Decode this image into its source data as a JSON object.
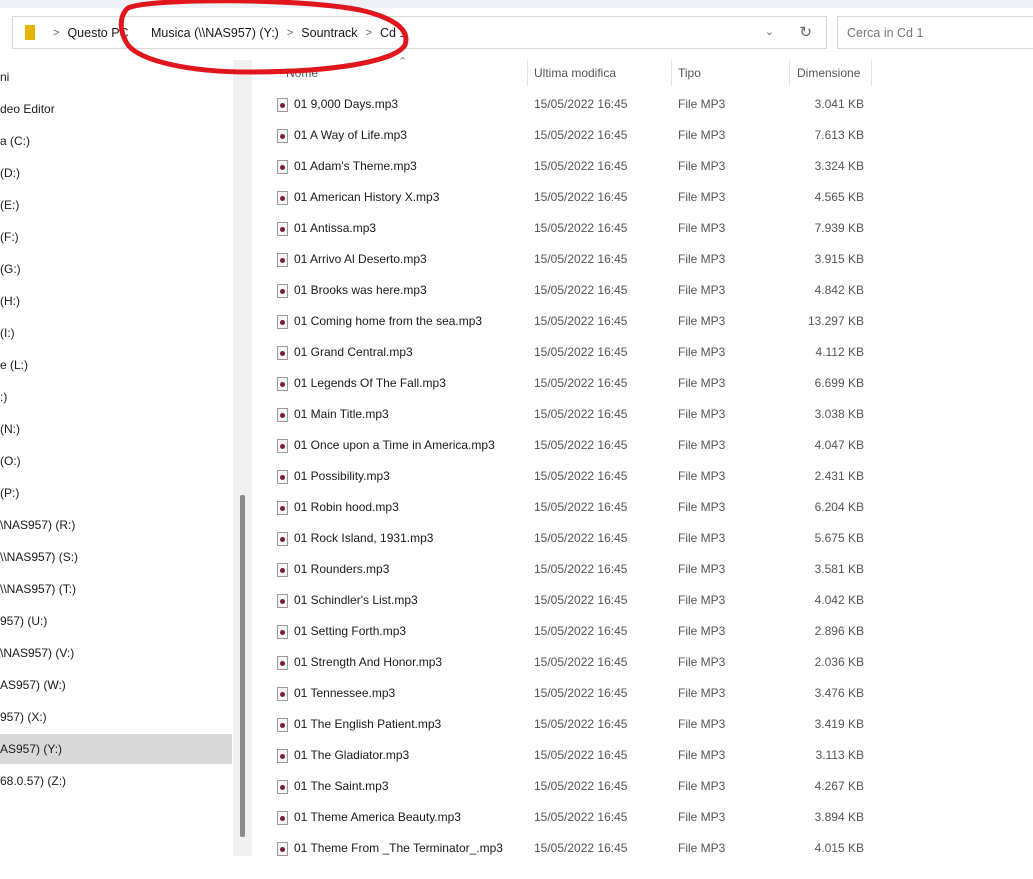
{
  "address": {
    "crumbs": [
      "Questo PC",
      "Musica (\\\\NAS957) (Y:)",
      "Sountrack",
      "Cd 1"
    ]
  },
  "search": {
    "placeholder": "Cerca in Cd 1"
  },
  "sidebar": {
    "items": [
      "ni",
      "deo Editor",
      "a (C:)",
      "(D:)",
      "(E:)",
      "(F:)",
      "(G:)",
      "(H:)",
      "(I:)",
      "e (L:)",
      ":)",
      "(N:)",
      "(O:)",
      "(P:)",
      "\\NAS957) (R:)",
      "\\\\NAS957) (S:)",
      "\\\\NAS957) (T:)",
      "957) (U:)",
      "\\NAS957) (V:)",
      "AS957) (W:)",
      "957) (X:)",
      "AS957) (Y:)",
      "68.0.57) (Z:)"
    ],
    "selected_index": 21
  },
  "columns": {
    "name": "Nome",
    "modified": "Ultima modifica",
    "type": "Tipo",
    "size": "Dimensione"
  },
  "files": [
    {
      "name": "01 9,000 Days.mp3",
      "date": "15/05/2022 16:45",
      "type": "File MP3",
      "size": "3.041 KB"
    },
    {
      "name": "01 A Way of Life.mp3",
      "date": "15/05/2022 16:45",
      "type": "File MP3",
      "size": "7.613 KB"
    },
    {
      "name": "01 Adam's Theme.mp3",
      "date": "15/05/2022 16:45",
      "type": "File MP3",
      "size": "3.324 KB"
    },
    {
      "name": "01 American History X.mp3",
      "date": "15/05/2022 16:45",
      "type": "File MP3",
      "size": "4.565 KB"
    },
    {
      "name": "01 Antissa.mp3",
      "date": "15/05/2022 16:45",
      "type": "File MP3",
      "size": "7.939 KB"
    },
    {
      "name": "01 Arrivo Al Deserto.mp3",
      "date": "15/05/2022 16:45",
      "type": "File MP3",
      "size": "3.915 KB"
    },
    {
      "name": "01 Brooks was here.mp3",
      "date": "15/05/2022 16:45",
      "type": "File MP3",
      "size": "4.842 KB"
    },
    {
      "name": "01 Coming home from the sea.mp3",
      "date": "15/05/2022 16:45",
      "type": "File MP3",
      "size": "13.297 KB"
    },
    {
      "name": "01 Grand Central.mp3",
      "date": "15/05/2022 16:45",
      "type": "File MP3",
      "size": "4.112 KB"
    },
    {
      "name": "01 Legends Of The Fall.mp3",
      "date": "15/05/2022 16:45",
      "type": "File MP3",
      "size": "6.699 KB"
    },
    {
      "name": "01 Main Title.mp3",
      "date": "15/05/2022 16:45",
      "type": "File MP3",
      "size": "3.038 KB"
    },
    {
      "name": "01 Once upon a Time in America.mp3",
      "date": "15/05/2022 16:45",
      "type": "File MP3",
      "size": "4.047 KB"
    },
    {
      "name": "01 Possibility.mp3",
      "date": "15/05/2022 16:45",
      "type": "File MP3",
      "size": "2.431 KB"
    },
    {
      "name": "01 Robin hood.mp3",
      "date": "15/05/2022 16:45",
      "type": "File MP3",
      "size": "6.204 KB"
    },
    {
      "name": "01 Rock Island, 1931.mp3",
      "date": "15/05/2022 16:45",
      "type": "File MP3",
      "size": "5.675 KB"
    },
    {
      "name": "01 Rounders.mp3",
      "date": "15/05/2022 16:45",
      "type": "File MP3",
      "size": "3.581 KB"
    },
    {
      "name": "01 Schindler's List.mp3",
      "date": "15/05/2022 16:45",
      "type": "File MP3",
      "size": "4.042 KB"
    },
    {
      "name": "01 Setting Forth.mp3",
      "date": "15/05/2022 16:45",
      "type": "File MP3",
      "size": "2.896 KB"
    },
    {
      "name": "01 Strength And Honor.mp3",
      "date": "15/05/2022 16:45",
      "type": "File MP3",
      "size": "2.036 KB"
    },
    {
      "name": "01 Tennessee.mp3",
      "date": "15/05/2022 16:45",
      "type": "File MP3",
      "size": "3.476 KB"
    },
    {
      "name": "01 The English Patient.mp3",
      "date": "15/05/2022 16:45",
      "type": "File MP3",
      "size": "3.419 KB"
    },
    {
      "name": "01 The Gladiator.mp3",
      "date": "15/05/2022 16:45",
      "type": "File MP3",
      "size": "3.113 KB"
    },
    {
      "name": "01 The Saint.mp3",
      "date": "15/05/2022 16:45",
      "type": "File MP3",
      "size": "4.267 KB"
    },
    {
      "name": "01 Theme America Beauty.mp3",
      "date": "15/05/2022 16:45",
      "type": "File MP3",
      "size": "3.894 KB"
    },
    {
      "name": "01 Theme From _The Terminator_.mp3",
      "date": "15/05/2022 16:45",
      "type": "File MP3",
      "size": "4.015 KB"
    }
  ],
  "colors": {
    "annotation": "#e0161c",
    "folder": "#e3b400",
    "selected": "#d9d9d9"
  }
}
